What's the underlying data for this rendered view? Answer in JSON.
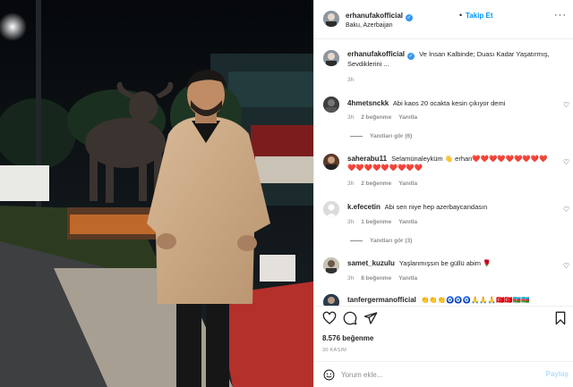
{
  "header": {
    "username": "erhanufakofficial",
    "separator": "•",
    "follow_label": "Takip Et",
    "location": "Baku, Azerbaijan",
    "more_label": "···"
  },
  "caption": {
    "username": "erhanufakofficial",
    "text": "Ve İnsan Kalbinde; Duası Kadar Yaşatırmış, Sevdiklerini ...",
    "time": "3h"
  },
  "comments": [
    {
      "username": "4hmetsnckk",
      "text": "Abi kaos 20 ocakta kesin çıkıyor demi",
      "time": "3h",
      "likes": "2 beğenme",
      "reply_label": "Yanıtla",
      "view_replies": "Yanıtları gör (6)"
    },
    {
      "username": "saherabu11",
      "text": "Selamünaleyküm 👋 erhan❤️❤️❤️❤️❤️❤️❤️❤️❤️❤️❤️❤️❤️❤️❤️❤️❤️❤️",
      "time": "3h",
      "likes": "2 beğenme",
      "reply_label": "Yanıtla"
    },
    {
      "username": "k.efecetin",
      "text": "Abi sen niye hep azerbaycandasın",
      "time": "3h",
      "likes": "1 beğenme",
      "reply_label": "Yanıtla",
      "view_replies": "Yanıtları gör (3)"
    },
    {
      "username": "samet_kuzulu",
      "text": "Yaşlanmışsın be güllü abim 🌹",
      "time": "3h",
      "likes": "8 beğenme",
      "reply_label": "Yanıtla"
    },
    {
      "username": "tanfergermanofficial",
      "text": "👏👏👏🧿🧿🧿🙏🙏🙏🇹🇷🇹🇷🇦🇿🇦🇿"
    }
  ],
  "actions": {
    "likes": "8.576 beğenme",
    "date": "30 KASIM"
  },
  "composer": {
    "placeholder": "Yorum ekle...",
    "post_label": "Paylaş"
  },
  "icons": {
    "verified": "verified-badge-icon",
    "like": "heart-icon",
    "comment": "comment-icon",
    "share": "share-icon",
    "save": "bookmark-icon",
    "emoji": "smiley-icon",
    "verified_glyph": "✓",
    "heart_glyph": "♡"
  },
  "colors": {
    "accent": "#0095f6",
    "post_disabled": "#b2dffc",
    "secondary_text": "#8e8e8e",
    "verified": "#3897f0"
  }
}
